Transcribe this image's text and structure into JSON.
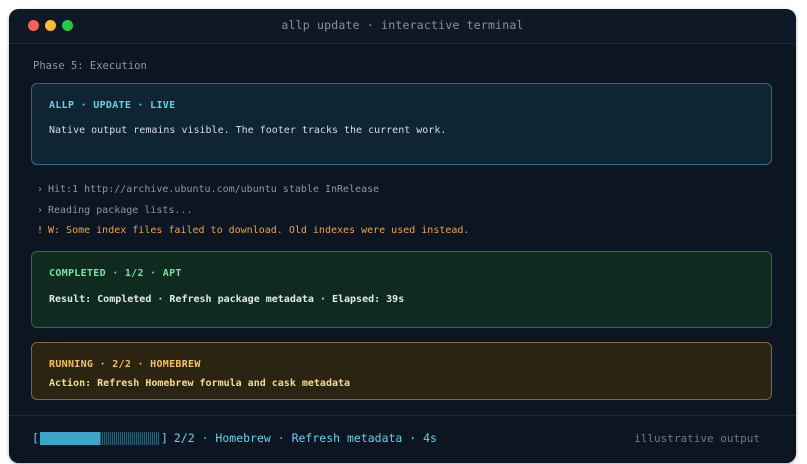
{
  "window": {
    "title": "allp update · interactive terminal"
  },
  "phase_label": "Phase 5: Execution",
  "live_card": {
    "header": "ALLP · UPDATE · LIVE",
    "body": "Native output remains visible. The footer tracks the current work."
  },
  "log_lines": [
    {
      "prefix": "›",
      "text": "Hit:1 http://archive.ubuntu.com/ubuntu stable InRelease",
      "kind": "info"
    },
    {
      "prefix": "›",
      "text": "Reading package lists...",
      "kind": "info"
    },
    {
      "prefix": "!",
      "text": "W: Some index files failed to download. Old indexes were used instead.",
      "kind": "warn"
    }
  ],
  "completed_card": {
    "header": "COMPLETED · 1/2 · APT",
    "body": "Result: Completed · Refresh package metadata · Elapsed: 39s"
  },
  "running_card": {
    "header": "RUNNING · 2/2 · HOMEBREW",
    "body": "Action: Refresh Homebrew formula and cask metadata"
  },
  "footer": {
    "bracket_open": "[",
    "bracket_close": "]",
    "progress_fraction": 0.5,
    "status_text": "2/2 · Homebrew · Refresh metadata · 4s",
    "note": "illustrative output"
  },
  "colors": {
    "accent": "#5fd4ec",
    "success": "#74e3a3",
    "warning": "#f5c257",
    "warn_text": "#f0a43a",
    "background": "#0c1522"
  },
  "icons": {
    "close": "close-dot-icon",
    "minimize": "minimize-dot-icon",
    "zoom": "zoom-dot-icon"
  }
}
